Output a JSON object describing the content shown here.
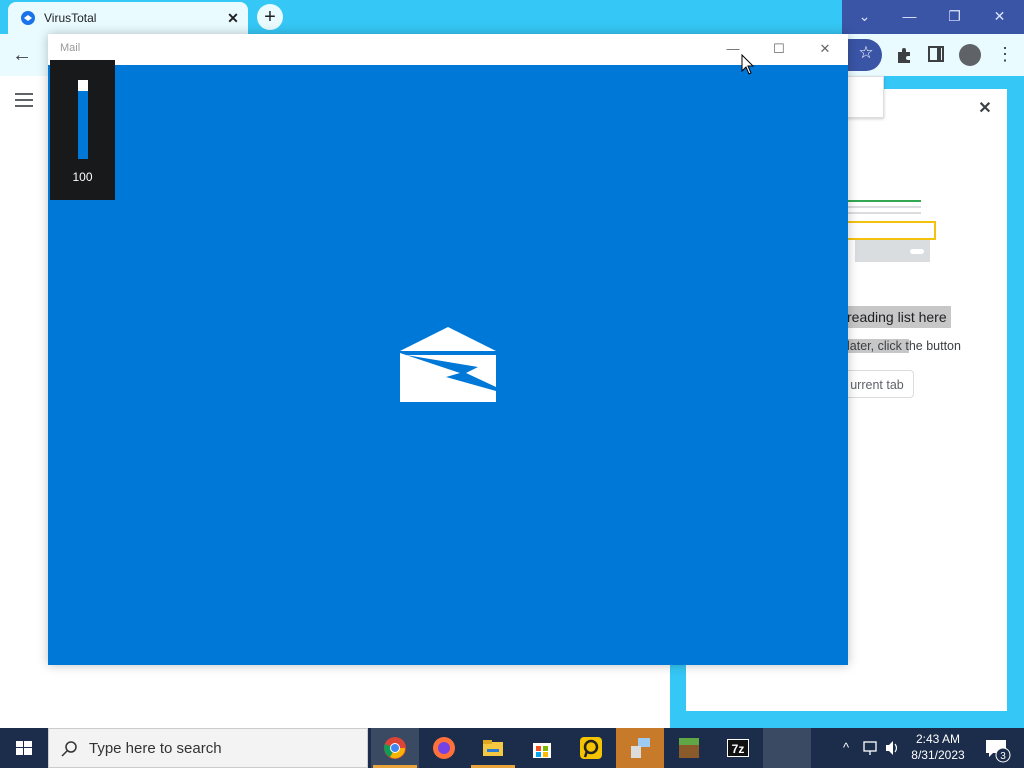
{
  "browser": {
    "tab_title": "VirusTotal",
    "tab_close": "✕",
    "new_tab": "+",
    "window_controls": {
      "dropdown": "⌄",
      "minimize": "—",
      "restore": "❐",
      "close": "✕"
    }
  },
  "side_panel": {
    "close": "✕",
    "empty_heading": "reading list here",
    "empty_body_highlight": "later, click t",
    "empty_body_rest": "he button",
    "add_button_label": "urrent tab"
  },
  "mail": {
    "title": "Mail",
    "controls": {
      "minimize": "—",
      "maximize": "☐",
      "close": "✕"
    },
    "accent": "#0078d7"
  },
  "volume": {
    "value": "100",
    "level": 1.0
  },
  "taskbar": {
    "search_placeholder": "Type here to search",
    "apps": [
      "chrome-icon",
      "firefox-icon",
      "file-explorer-icon",
      "store-icon",
      "app-icon",
      "network-icon",
      "minecraft-icon",
      "7zip-icon",
      "blank-app"
    ],
    "clock": {
      "time": "2:43 AM",
      "date": "8/31/2023"
    },
    "notifications_count": "3"
  }
}
